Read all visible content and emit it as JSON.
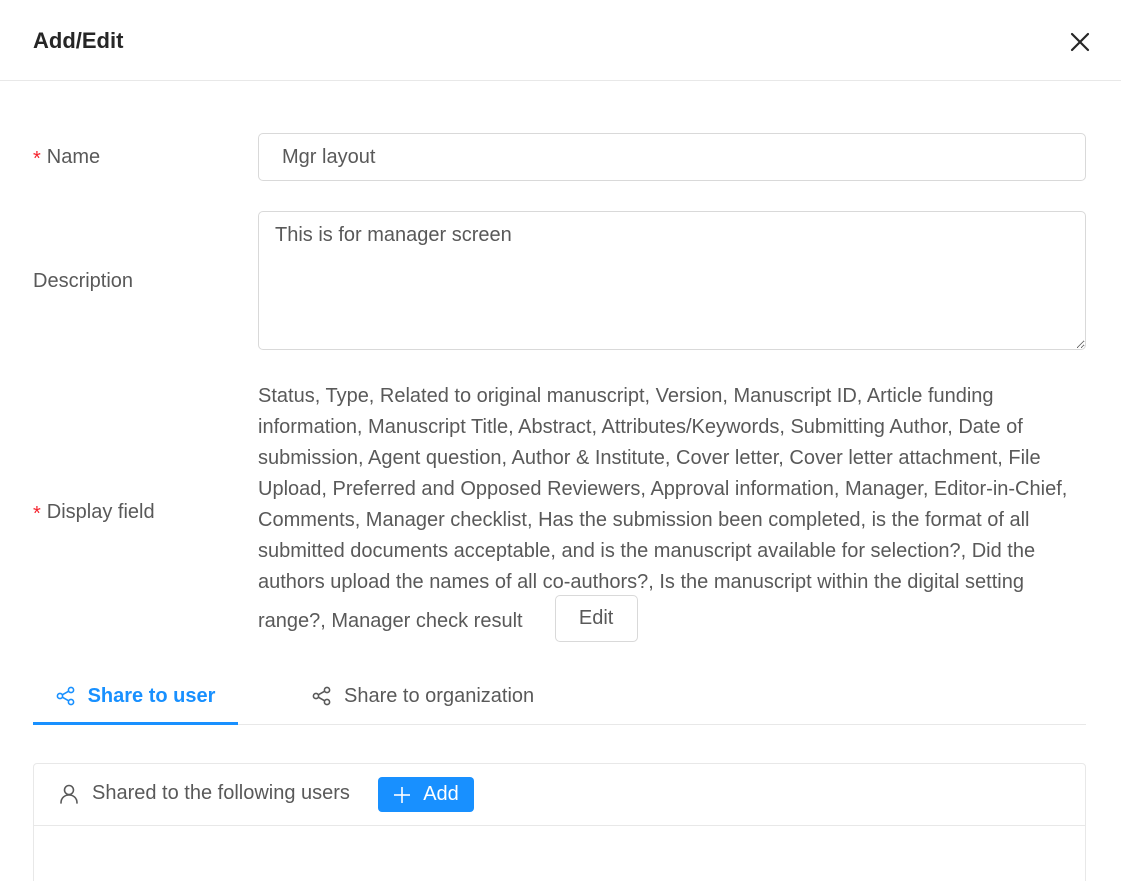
{
  "modal": {
    "title": "Add/Edit"
  },
  "form": {
    "name": {
      "label": "Name",
      "value": "Mgr layout"
    },
    "description": {
      "label": "Description",
      "value": "This is for manager screen"
    },
    "display_field": {
      "label": "Display field",
      "value": "Status, Type, Related to original manuscript, Version, Manuscript ID, Article funding information, Manuscript Title, Abstract, Attributes/Keywords, Submitting Author, Date of submission, Agent question, Author & Institute, Cover letter, Cover letter attachment, File Upload, Preferred and Opposed Reviewers, Approval information, Manager, Editor-in-Chief, Comments, Manager checklist, Has the submission been completed, is the format of all submitted documents acceptable, and is the manuscript available for selection?, Did the authors upload the names of all co-authors?, Is the manuscript within the digital setting range?, Manager check result",
      "edit_label": "Edit"
    }
  },
  "tabs": [
    {
      "label": "Share to user",
      "active": true,
      "icon": "share-icon"
    },
    {
      "label": "Share to organization",
      "active": false,
      "icon": "share-icon"
    }
  ],
  "share_panel": {
    "title": "Shared to the following users",
    "icon": "user-icon",
    "add_label": "Add"
  },
  "colors": {
    "primary": "#1890ff",
    "required": "#f5222d",
    "border": "#d9d9d9",
    "text": "#595959",
    "title": "#262626"
  }
}
